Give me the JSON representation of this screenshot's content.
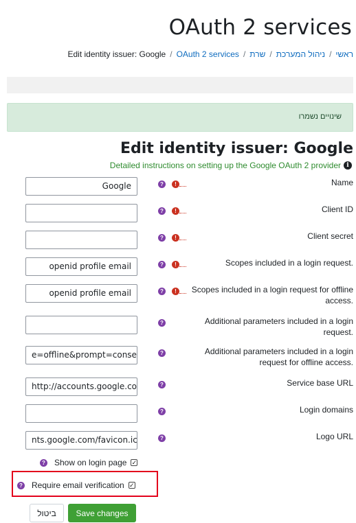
{
  "page_title": "OAuth 2 services",
  "breadcrumb": {
    "items": [
      "ראשי",
      "ניהול המערכת",
      "שרת",
      "OAuth 2 services"
    ],
    "current": "Edit identity issuer: Google",
    "separator": "/"
  },
  "alert": {
    "text": "שינויים נשמרו"
  },
  "form": {
    "title": "Edit identity issuer: Google",
    "instructions_link": "Detailed instructions on setting up the Google OAuth 2 provider",
    "fields": [
      {
        "label": "Name",
        "value": "Google",
        "required": true
      },
      {
        "label": "Client ID",
        "value": "",
        "required": true
      },
      {
        "label": "Client secret",
        "value": "",
        "required": true
      },
      {
        "label": "Scopes included in a login request.",
        "value": "openid profile email",
        "required": true
      },
      {
        "label": "Scopes included in a login request for offline access.",
        "value": "openid profile email",
        "required": true
      },
      {
        "label": "Additional parameters included in a login request.",
        "value": "",
        "required": false
      },
      {
        "label": "Additional parameters included in a login request for offline access.",
        "value": "e=offline&prompt=consent",
        "required": false
      },
      {
        "label": "Service base URL",
        "value": "http://accounts.google.com",
        "required": false
      },
      {
        "label": "Login domains",
        "value": "",
        "required": false
      },
      {
        "label": "Logo URL",
        "value": "nts.google.com/favicon.ico",
        "required": false
      }
    ],
    "show_on_login_page": {
      "label": "Show on login page",
      "checked": true
    },
    "require_email_verification": {
      "label": "Require email verification",
      "checked": true
    },
    "cancel_label": "ביטול",
    "save_label": "Save changes"
  },
  "colors": {
    "link": "#0f6cbf",
    "success_bg": "#d7ebdc",
    "help_icon": "#7e3fa7",
    "required_icon": "#ca3120",
    "save_button": "#3fa035",
    "highlight": "#e3001b"
  }
}
